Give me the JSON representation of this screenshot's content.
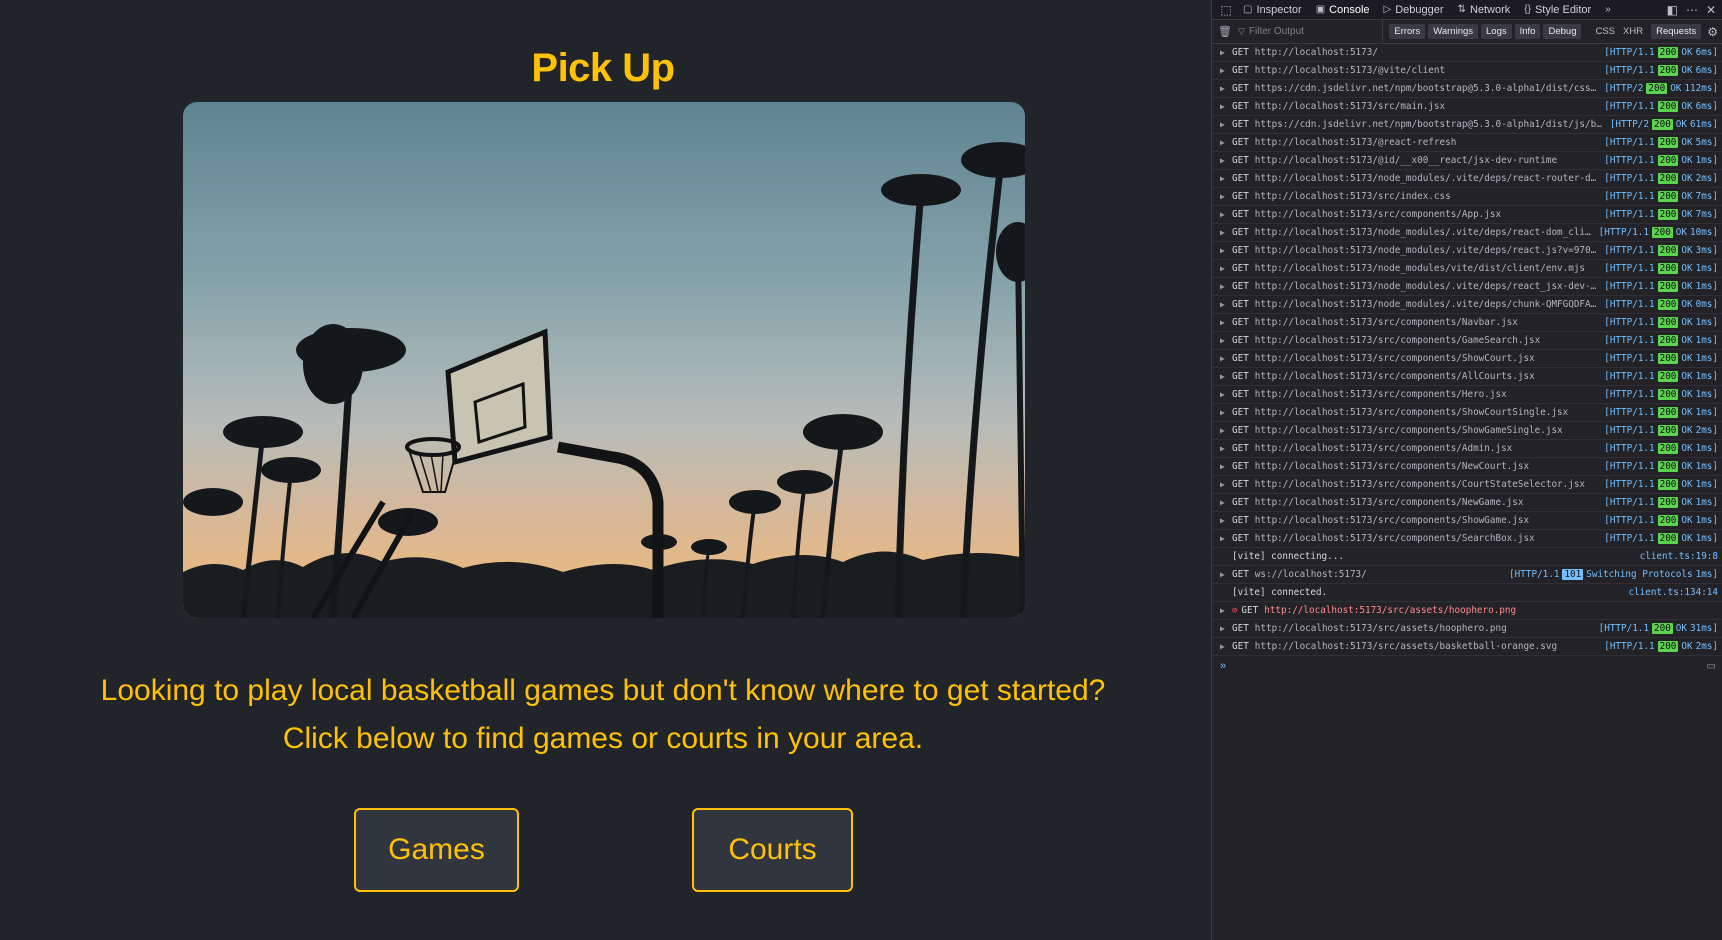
{
  "app": {
    "title": "Pick Up",
    "hero_image_alt": "Basketball hoop silhouette with palm trees at sunset",
    "tagline_line1": "Looking to play local basketball games but don't know where to get started?",
    "tagline_line2": "Click below to find games or courts in your area.",
    "buttons": {
      "games": "Games",
      "courts": "Courts"
    },
    "colors": {
      "accent": "#ffc107",
      "background": "#212529",
      "button_bg": "#31353e"
    }
  },
  "devtools": {
    "tabs": [
      {
        "label": "Inspector",
        "icon": "inspector-icon"
      },
      {
        "label": "Console",
        "icon": "console-icon",
        "active": true
      },
      {
        "label": "Debugger",
        "icon": "debugger-icon"
      },
      {
        "label": "Network",
        "icon": "network-icon"
      },
      {
        "label": "Style Editor",
        "icon": "style-editor-icon"
      }
    ],
    "filter_placeholder": "Filter Output",
    "levels": [
      "Errors",
      "Warnings",
      "Logs",
      "Info",
      "Debug"
    ],
    "request_filters": {
      "css": "CSS",
      "xhr": "XHR",
      "requests": "Requests"
    },
    "log": [
      {
        "kind": "req",
        "method": "GET",
        "url": "http://localhost:5173/",
        "proto": "[HTTP/1.1",
        "status": "200",
        "text": "OK",
        "time": "6ms]"
      },
      {
        "kind": "req",
        "method": "GET",
        "url": "http://localhost:5173/@vite/client",
        "proto": "[HTTP/1.1",
        "status": "200",
        "text": "OK",
        "time": "6ms]"
      },
      {
        "kind": "req",
        "method": "GET",
        "url": "https://cdn.jsdelivr.net/npm/bootstrap@5.3.0-alpha1/dist/css/bo…",
        "proto": "[HTTP/2",
        "status": "200",
        "text": "OK",
        "time": "112ms]"
      },
      {
        "kind": "req",
        "method": "GET",
        "url": "http://localhost:5173/src/main.jsx",
        "proto": "[HTTP/1.1",
        "status": "200",
        "text": "OK",
        "time": "6ms]"
      },
      {
        "kind": "req",
        "method": "GET",
        "url": "https://cdn.jsdelivr.net/npm/bootstrap@5.3.0-alpha1/dist/js/boot…",
        "proto": "[HTTP/2",
        "status": "200",
        "text": "OK",
        "time": "61ms]"
      },
      {
        "kind": "req",
        "method": "GET",
        "url": "http://localhost:5173/@react-refresh",
        "proto": "[HTTP/1.1",
        "status": "200",
        "text": "OK",
        "time": "5ms]"
      },
      {
        "kind": "req",
        "method": "GET",
        "url": "http://localhost:5173/@id/__x00__react/jsx-dev-runtime",
        "proto": "[HTTP/1.1",
        "status": "200",
        "text": "OK",
        "time": "1ms]"
      },
      {
        "kind": "req",
        "method": "GET",
        "url": "http://localhost:5173/node_modules/.vite/deps/react-router-dom.…",
        "proto": "[HTTP/1.1",
        "status": "200",
        "text": "OK",
        "time": "2ms]"
      },
      {
        "kind": "req",
        "method": "GET",
        "url": "http://localhost:5173/src/index.css",
        "proto": "[HTTP/1.1",
        "status": "200",
        "text": "OK",
        "time": "7ms]"
      },
      {
        "kind": "req",
        "method": "GET",
        "url": "http://localhost:5173/src/components/App.jsx",
        "proto": "[HTTP/1.1",
        "status": "200",
        "text": "OK",
        "time": "7ms]"
      },
      {
        "kind": "req",
        "method": "GET",
        "url": "http://localhost:5173/node_modules/.vite/deps/react-dom_client…",
        "proto": "[HTTP/1.1",
        "status": "200",
        "text": "OK",
        "time": "10ms]"
      },
      {
        "kind": "req",
        "method": "GET",
        "url": "http://localhost:5173/node_modules/.vite/deps/react.js?v=970141…",
        "proto": "[HTTP/1.1",
        "status": "200",
        "text": "OK",
        "time": "3ms]"
      },
      {
        "kind": "req",
        "method": "GET",
        "url": "http://localhost:5173/node_modules/vite/dist/client/env.mjs",
        "proto": "[HTTP/1.1",
        "status": "200",
        "text": "OK",
        "time": "1ms]"
      },
      {
        "kind": "req",
        "method": "GET",
        "url": "http://localhost:5173/node_modules/.vite/deps/react_jsx-dev-run…",
        "proto": "[HTTP/1.1",
        "status": "200",
        "text": "OK",
        "time": "1ms]"
      },
      {
        "kind": "req",
        "method": "GET",
        "url": "http://localhost:5173/node_modules/.vite/deps/chunk-QMFGQDFA.js…",
        "proto": "[HTTP/1.1",
        "status": "200",
        "text": "OK",
        "time": "0ms]"
      },
      {
        "kind": "req",
        "method": "GET",
        "url": "http://localhost:5173/src/components/Navbar.jsx",
        "proto": "[HTTP/1.1",
        "status": "200",
        "text": "OK",
        "time": "1ms]"
      },
      {
        "kind": "req",
        "method": "GET",
        "url": "http://localhost:5173/src/components/GameSearch.jsx",
        "proto": "[HTTP/1.1",
        "status": "200",
        "text": "OK",
        "time": "1ms]"
      },
      {
        "kind": "req",
        "method": "GET",
        "url": "http://localhost:5173/src/components/ShowCourt.jsx",
        "proto": "[HTTP/1.1",
        "status": "200",
        "text": "OK",
        "time": "1ms]"
      },
      {
        "kind": "req",
        "method": "GET",
        "url": "http://localhost:5173/src/components/AllCourts.jsx",
        "proto": "[HTTP/1.1",
        "status": "200",
        "text": "OK",
        "time": "1ms]"
      },
      {
        "kind": "req",
        "method": "GET",
        "url": "http://localhost:5173/src/components/Hero.jsx",
        "proto": "[HTTP/1.1",
        "status": "200",
        "text": "OK",
        "time": "1ms]"
      },
      {
        "kind": "req",
        "method": "GET",
        "url": "http://localhost:5173/src/components/ShowCourtSingle.jsx",
        "proto": "[HTTP/1.1",
        "status": "200",
        "text": "OK",
        "time": "1ms]"
      },
      {
        "kind": "req",
        "method": "GET",
        "url": "http://localhost:5173/src/components/ShowGameSingle.jsx",
        "proto": "[HTTP/1.1",
        "status": "200",
        "text": "OK",
        "time": "2ms]"
      },
      {
        "kind": "req",
        "method": "GET",
        "url": "http://localhost:5173/src/components/Admin.jsx",
        "proto": "[HTTP/1.1",
        "status": "200",
        "text": "OK",
        "time": "1ms]"
      },
      {
        "kind": "req",
        "method": "GET",
        "url": "http://localhost:5173/src/components/NewCourt.jsx",
        "proto": "[HTTP/1.1",
        "status": "200",
        "text": "OK",
        "time": "1ms]"
      },
      {
        "kind": "req",
        "method": "GET",
        "url": "http://localhost:5173/src/components/CourtStateSelector.jsx",
        "proto": "[HTTP/1.1",
        "status": "200",
        "text": "OK",
        "time": "1ms]"
      },
      {
        "kind": "req",
        "method": "GET",
        "url": "http://localhost:5173/src/components/NewGame.jsx",
        "proto": "[HTTP/1.1",
        "status": "200",
        "text": "OK",
        "time": "1ms]"
      },
      {
        "kind": "req",
        "method": "GET",
        "url": "http://localhost:5173/src/components/ShowGame.jsx",
        "proto": "[HTTP/1.1",
        "status": "200",
        "text": "OK",
        "time": "1ms]"
      },
      {
        "kind": "req",
        "method": "GET",
        "url": "http://localhost:5173/src/components/SearchBox.jsx",
        "proto": "[HTTP/1.1",
        "status": "200",
        "text": "OK",
        "time": "1ms]"
      },
      {
        "kind": "msg",
        "text": "[vite] connecting...",
        "source": "client.ts:19:8"
      },
      {
        "kind": "req",
        "method": "GET",
        "url": "ws://localhost:5173/",
        "proto": "[HTTP/1.1",
        "status": "101",
        "text": "Switching Protocols",
        "time": "1ms]",
        "info": true
      },
      {
        "kind": "msg",
        "text": "[vite] connected.",
        "source": "client.ts:134:14"
      },
      {
        "kind": "blocked",
        "method": "GET",
        "url": "http://localhost:5173/src/assets/hoophero.png"
      },
      {
        "kind": "req",
        "method": "GET",
        "url": "http://localhost:5173/src/assets/hoophero.png",
        "proto": "[HTTP/1.1",
        "status": "200",
        "text": "OK",
        "time": "31ms]"
      },
      {
        "kind": "req",
        "method": "GET",
        "url": "http://localhost:5173/src/assets/basketball-orange.svg",
        "proto": "[HTTP/1.1",
        "status": "200",
        "text": "OK",
        "time": "2ms]"
      }
    ],
    "prompt": "»"
  }
}
